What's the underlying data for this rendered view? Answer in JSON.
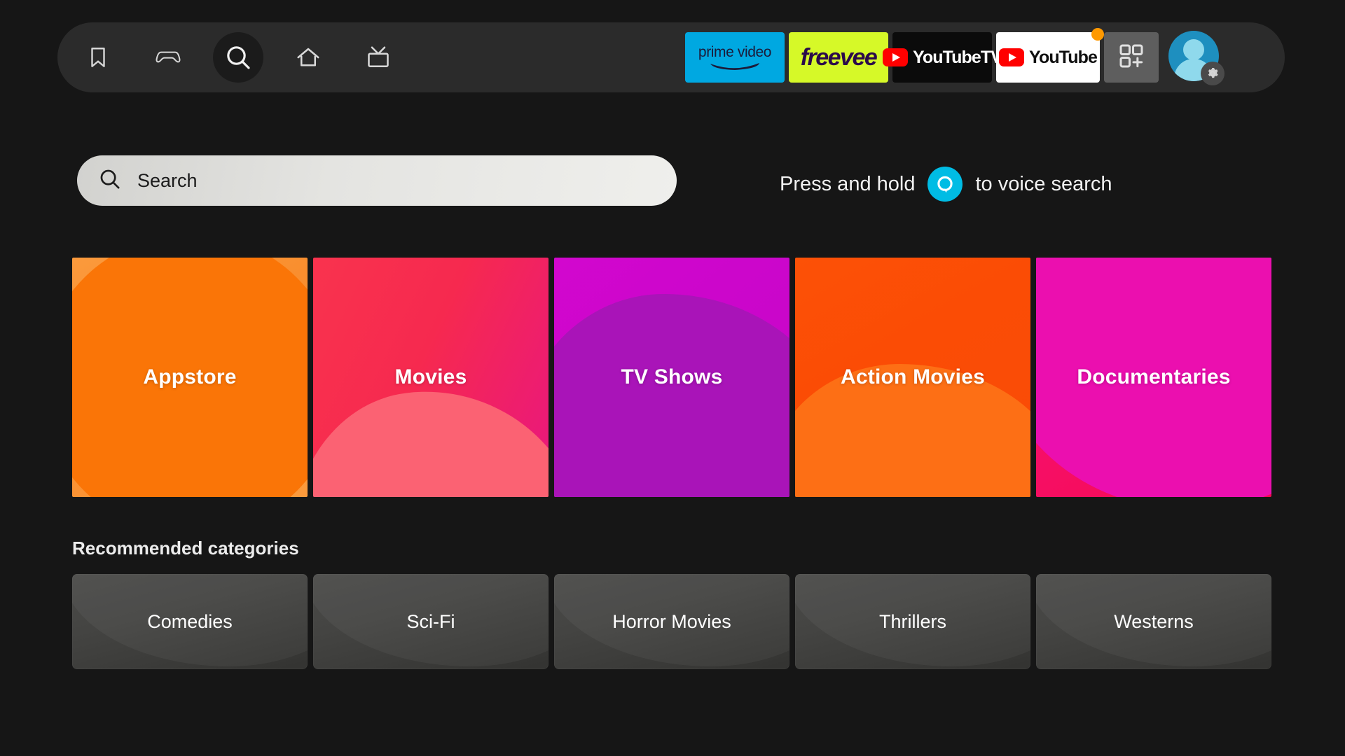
{
  "theme": {
    "page_background": "#161616",
    "navbar_background": "#2b2b2b",
    "accent_cyan": "#00BCE4",
    "accent_orange": "#FF9900"
  },
  "navbar": {
    "items": [
      {
        "icon": "bookmark-icon",
        "label": "Your Stuff",
        "selected": false
      },
      {
        "icon": "game-controller-icon",
        "label": "Games",
        "selected": false
      },
      {
        "icon": "search-icon",
        "label": "Search",
        "selected": true
      },
      {
        "icon": "home-icon",
        "label": "Home",
        "selected": false
      },
      {
        "icon": "live-tv-icon",
        "label": "Live TV",
        "selected": false
      }
    ],
    "app_tiles": [
      {
        "name": "prime-video",
        "label": "prime video",
        "background": "#00A8E1"
      },
      {
        "name": "freevee",
        "label": "freevee",
        "background": "#D6F928"
      },
      {
        "name": "youtube-tv",
        "label": "YouTubeTV",
        "background": "#0b0b0b"
      },
      {
        "name": "youtube",
        "label": "YouTube",
        "background": "#ffffff",
        "badge": true
      }
    ],
    "apps_grid": {
      "icon": "apps-grid-plus-icon",
      "label": "Apps"
    },
    "profile": {
      "icon": "profile-avatar",
      "badge_icon": "gear-icon"
    }
  },
  "search": {
    "placeholder": "Search",
    "icon": "search-icon",
    "voice_prefix": "Press and hold",
    "voice_suffix": "to voice search",
    "voice_icon": "alexa-icon"
  },
  "categories": {
    "tiles": [
      {
        "label": "Appstore",
        "color": "#FA7507"
      },
      {
        "label": "Movies",
        "color": "#F6294F"
      },
      {
        "label": "TV Shows",
        "color": "#CC06CB"
      },
      {
        "label": "Action Movies",
        "color": "#FB4C05"
      },
      {
        "label": "Documentaries",
        "color": "#F60F69"
      }
    ]
  },
  "recommended": {
    "heading": "Recommended categories",
    "tiles": [
      {
        "label": "Comedies"
      },
      {
        "label": "Sci-Fi"
      },
      {
        "label": "Horror Movies"
      },
      {
        "label": "Thrillers"
      },
      {
        "label": "Westerns"
      }
    ]
  }
}
